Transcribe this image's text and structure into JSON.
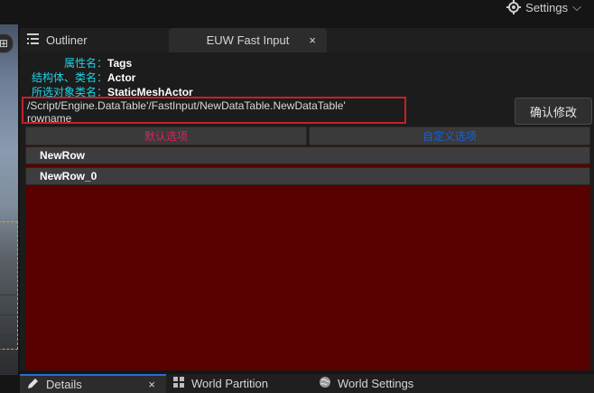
{
  "top": {
    "settings_label": "Settings",
    "settings_chevron": "⌵"
  },
  "viewport": {
    "button_icon": "⊞"
  },
  "tabs": {
    "outliner_label": "Outliner",
    "fastinput_label": "EUW Fast Input",
    "close_glyph": "×"
  },
  "info": {
    "property_key": "属性名：",
    "property_value": "Tags",
    "struct_key": "结构体、类名：",
    "struct_value": "Actor",
    "selected_key": "所选对象类名：",
    "selected_value": "StaticMeshActor"
  },
  "path": {
    "line1": "/Script/Engine.DataTable'/FastInput/NewDataTable.NewDataTable'",
    "line2": "rowname"
  },
  "confirm_label": "确认修改",
  "options": {
    "default_label": "默认选项",
    "custom_label": "自定义选项"
  },
  "rows": [
    "NewRow",
    "NewRow_0"
  ],
  "bottom_tabs": {
    "details_label": "Details",
    "world_partition_label": "World Partition",
    "world_settings_label": "World Settings",
    "close_glyph": "×"
  },
  "colors": {
    "accent_cyan": "#1fd2e6",
    "highlight_red": "#c6202a",
    "rows_background": "#590000",
    "default_option": "#e0205a",
    "custom_option": "#1a5fd8",
    "active_tab_line": "#2b6cd6"
  }
}
